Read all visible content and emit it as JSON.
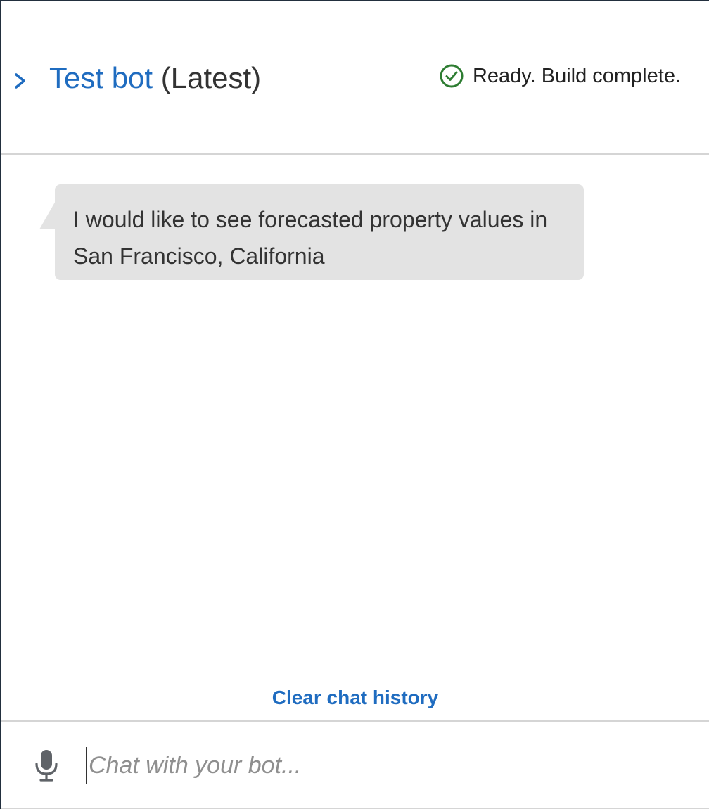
{
  "header": {
    "title_link": "Test bot",
    "title_suffix": "(Latest)",
    "status_text": "Ready. Build complete."
  },
  "chat": {
    "messages": [
      {
        "text": "I would like to see forecasted property values in San Francisco, California"
      }
    ],
    "clear_label": "Clear chat history"
  },
  "input": {
    "placeholder": "Chat with your bot...",
    "value": ""
  },
  "colors": {
    "link": "#1f6cc0",
    "status_ok": "#2e7d32",
    "bubble": "#e3e3e3"
  },
  "icons": {
    "expand": "chevron-right-icon",
    "status": "check-circle-icon",
    "mic": "microphone-icon"
  }
}
